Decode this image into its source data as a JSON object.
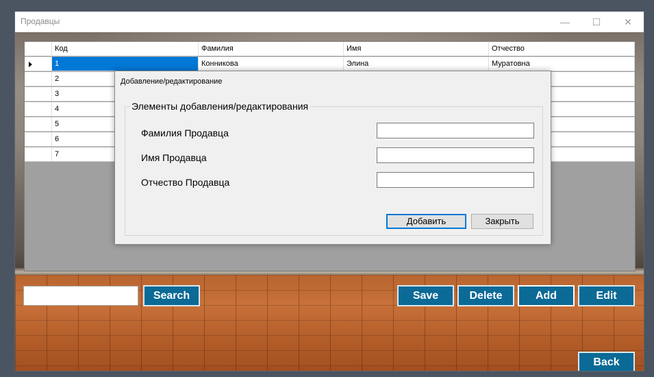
{
  "window": {
    "title": "Продавцы",
    "controls": {
      "minimize": "—",
      "maximize": "☐",
      "close": "✕"
    }
  },
  "grid": {
    "columns": [
      "Код",
      "Фамилия",
      "Имя",
      "Отчество"
    ],
    "rows": [
      {
        "code": "1",
        "last": "Конникова",
        "first": "Элина",
        "middle": "Муратовна"
      },
      {
        "code": "2",
        "last": "",
        "first": "",
        "middle": ""
      },
      {
        "code": "3",
        "last": "",
        "first": "",
        "middle": ""
      },
      {
        "code": "4",
        "last": "",
        "first": "",
        "middle": ""
      },
      {
        "code": "5",
        "last": "",
        "first": "",
        "middle": ""
      },
      {
        "code": "6",
        "last": "",
        "first": "",
        "middle": ""
      },
      {
        "code": "7",
        "last": "",
        "first": "",
        "middle": ""
      }
    ]
  },
  "toolbar": {
    "search_value": "",
    "search_label": "Search",
    "save_label": "Save",
    "delete_label": "Delete",
    "add_label": "Add",
    "edit_label": "Edit",
    "back_label": "Back"
  },
  "dialog": {
    "title": "Добавление/редактирование",
    "group_title": "Элементы добавления/редактирования",
    "fields": [
      {
        "label": "Фамилия Продавца",
        "value": ""
      },
      {
        "label": "Имя Продавца",
        "value": ""
      },
      {
        "label": "Отчество Продавца",
        "value": ""
      }
    ],
    "add_button": "Добавить",
    "close_button": "Закрыть"
  },
  "colors": {
    "accent_button": "#0b6a96",
    "selection": "#0078d7"
  }
}
